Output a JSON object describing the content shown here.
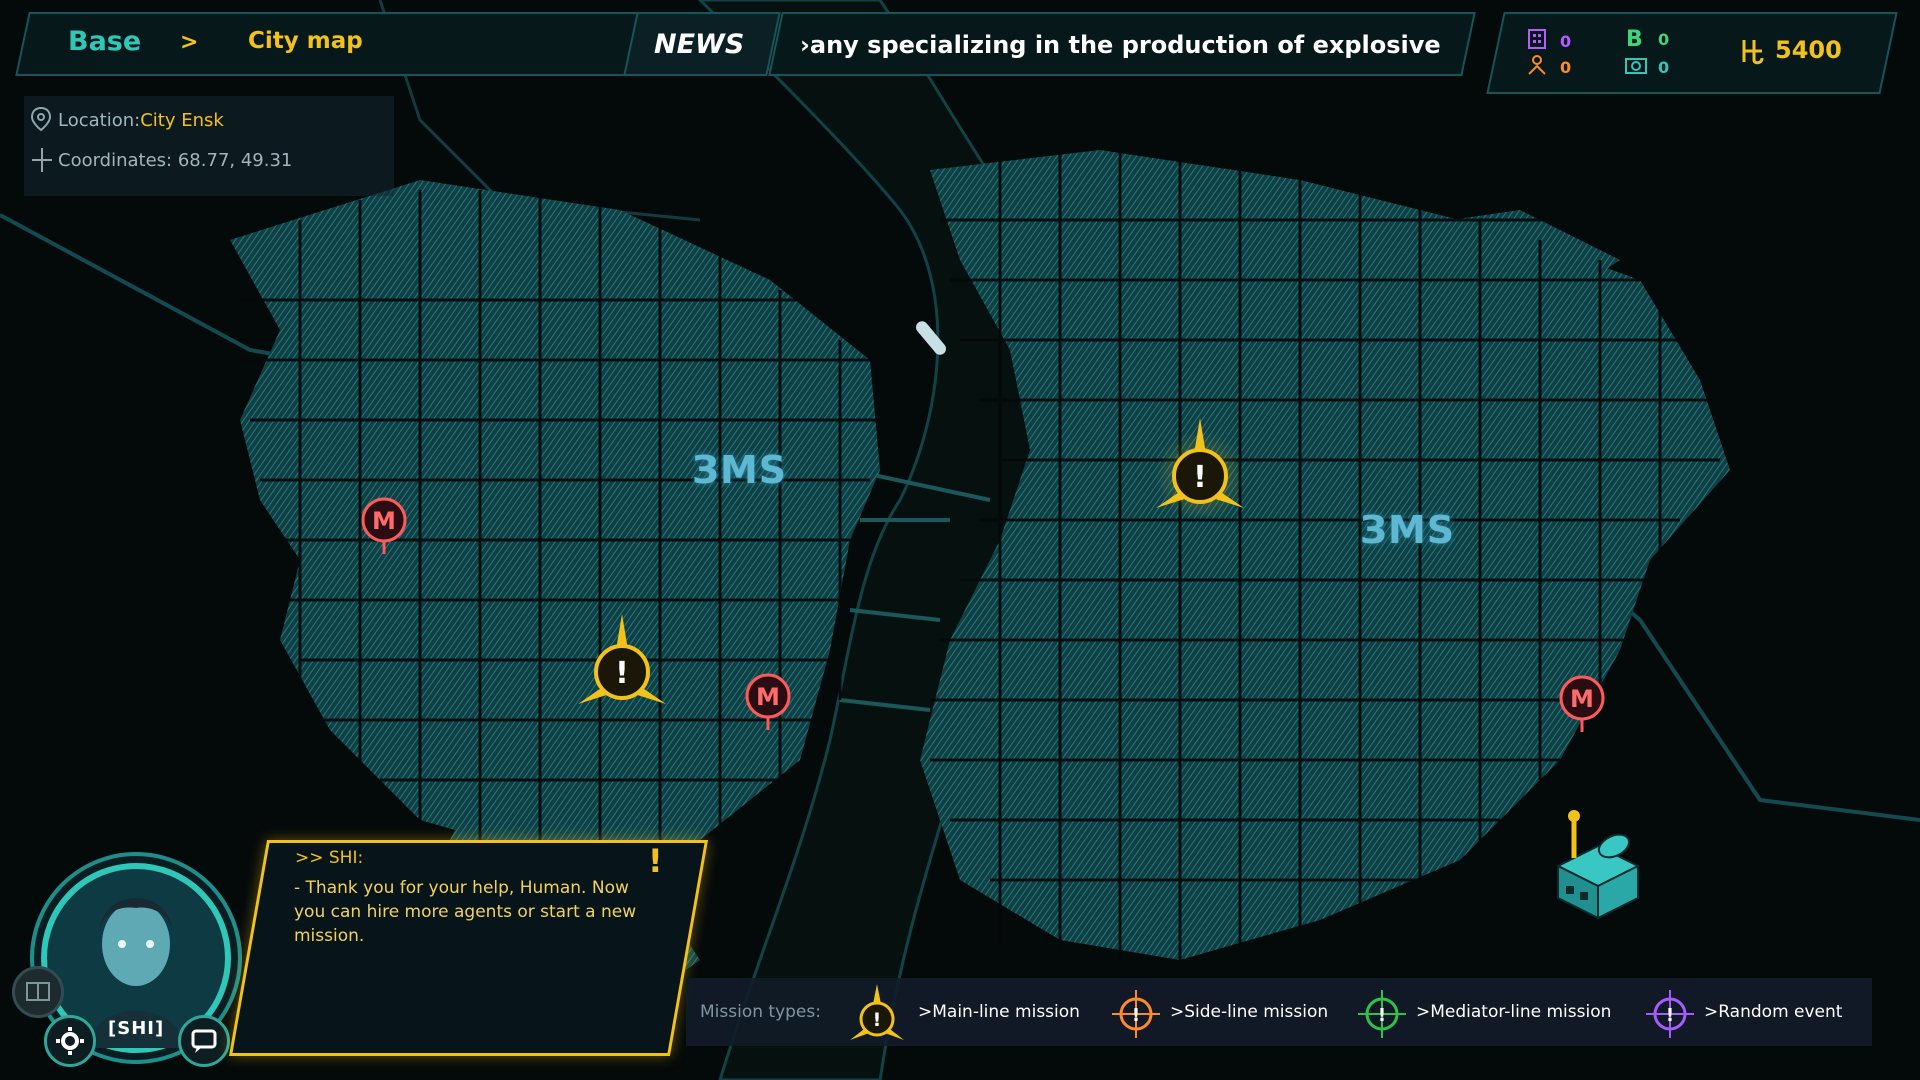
{
  "header": {
    "breadcrumb_base": "Base",
    "breadcrumb_separator": ">",
    "breadcrumb_current": "City map",
    "news_label": "NEWS",
    "news_ticker": "›any specializing in the production of explosives,"
  },
  "resources": {
    "items": [
      {
        "icon": "building-icon",
        "value": "0",
        "color": "#b45cff"
      },
      {
        "icon": "bitcoin-icon",
        "value": "0",
        "color": "#3fd37a"
      },
      {
        "icon": "agents-icon",
        "value": "0",
        "color": "#ff8a2a"
      },
      {
        "icon": "camera-icon",
        "value": "0",
        "color": "#2ec7b8"
      }
    ],
    "money_icon": "currency-icon",
    "money": "5400"
  },
  "location": {
    "location_label": "Location:",
    "location_value": "City Ensk",
    "coordinates_label": "Coordinates:",
    "coordinates_value": "68.77, 49.31"
  },
  "map": {
    "landmark_label": "ЗМS",
    "metro_symbol": "M",
    "mission_symbol": "!"
  },
  "dialog": {
    "speaker": ">> SHI:",
    "text": "- Thank you for your help, Human. Now you can hire more agents or start a new mission.",
    "alert": "!"
  },
  "avatar": {
    "name": "[SHI]"
  },
  "legend": {
    "title": "Mission types:",
    "items": [
      {
        "label": ">Main-line mission",
        "color": "#f2c21b",
        "icon": "main-mission-icon"
      },
      {
        "label": ">Side-line mission",
        "color": "#ff8a2a",
        "icon": "side-mission-icon"
      },
      {
        "label": ">Mediator-line mission",
        "color": "#2fc14a",
        "icon": "mediator-mission-icon"
      },
      {
        "label": ">Random event",
        "color": "#a45cff",
        "icon": "random-event-icon"
      }
    ]
  },
  "colors": {
    "accent": "#f2c21b",
    "teal": "#2ec7b8",
    "map_blocks": "#1c6e72",
    "background": "#04090a"
  }
}
